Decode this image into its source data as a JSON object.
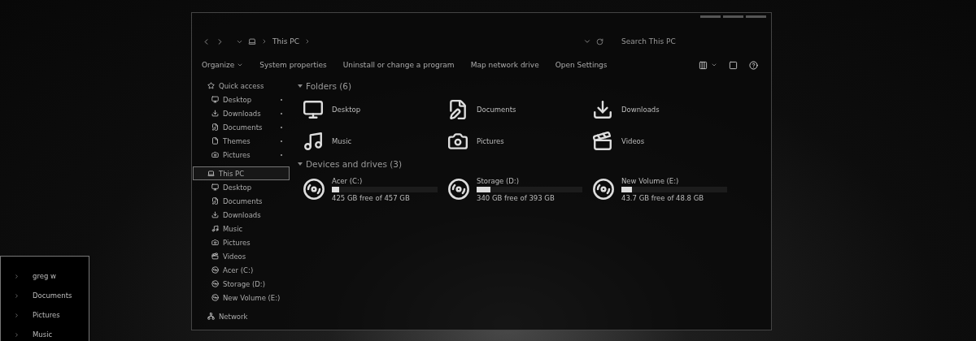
{
  "address": {
    "path": [
      {
        "label": "This PC"
      }
    ],
    "search_placeholder": "Search This PC"
  },
  "commands": [
    {
      "label": "Organize",
      "dropdown": true
    },
    {
      "label": "System properties",
      "dropdown": false
    },
    {
      "label": "Uninstall or change a program",
      "dropdown": false
    },
    {
      "label": "Map network drive",
      "dropdown": false
    },
    {
      "label": "Open Settings",
      "dropdown": false
    }
  ],
  "navigation": [
    {
      "label": "Quick access",
      "kind": "star",
      "selected": false,
      "children": [
        {
          "label": "Desktop",
          "kind": "desktop",
          "pinned": true
        },
        {
          "label": "Downloads",
          "kind": "download",
          "pinned": true
        },
        {
          "label": "Documents",
          "kind": "document",
          "pinned": true
        },
        {
          "label": "Themes",
          "kind": "file",
          "pinned": true
        },
        {
          "label": "Pictures",
          "kind": "camera",
          "pinned": true
        }
      ]
    },
    {
      "label": "This PC",
      "kind": "pc",
      "selected": true,
      "children": [
        {
          "label": "Desktop",
          "kind": "desktop",
          "pinned": false
        },
        {
          "label": "Documents",
          "kind": "document",
          "pinned": false
        },
        {
          "label": "Downloads",
          "kind": "download",
          "pinned": false
        },
        {
          "label": "Music",
          "kind": "music",
          "pinned": false
        },
        {
          "label": "Pictures",
          "kind": "camera",
          "pinned": false
        },
        {
          "label": "Videos",
          "kind": "video",
          "pinned": false
        },
        {
          "label": "Acer (C:)",
          "kind": "drive",
          "pinned": false
        },
        {
          "label": "Storage (D:)",
          "kind": "drive",
          "pinned": false
        },
        {
          "label": "New Volume (E:)",
          "kind": "drive",
          "pinned": false
        }
      ]
    },
    {
      "label": "Network",
      "kind": "network",
      "selected": false
    }
  ],
  "folders": {
    "heading": "Folders (6)",
    "expanded": true,
    "items": [
      {
        "label": "Desktop",
        "kind": "desktop"
      },
      {
        "label": "Documents",
        "kind": "document"
      },
      {
        "label": "Downloads",
        "kind": "download"
      },
      {
        "label": "Music",
        "kind": "music"
      },
      {
        "label": "Pictures",
        "kind": "camera"
      },
      {
        "label": "Videos",
        "kind": "video"
      }
    ]
  },
  "drives": {
    "heading": "Devices and drives (3)",
    "expanded": true,
    "items": [
      {
        "label": "Acer (C:)",
        "level": 0.07,
        "space": "425 GB free of 457 GB"
      },
      {
        "label": "Storage (D:)",
        "level": 0.13,
        "space": "340 GB free of 393 GB"
      },
      {
        "label": "New Volume (E:)",
        "level": 0.1,
        "space": "43.7 GB free of 48.8 GB"
      }
    ]
  },
  "start_menu": {
    "items": [
      {
        "label": "greg w"
      },
      {
        "label": "Documents"
      },
      {
        "label": "Pictures"
      },
      {
        "label": "Music"
      }
    ]
  }
}
